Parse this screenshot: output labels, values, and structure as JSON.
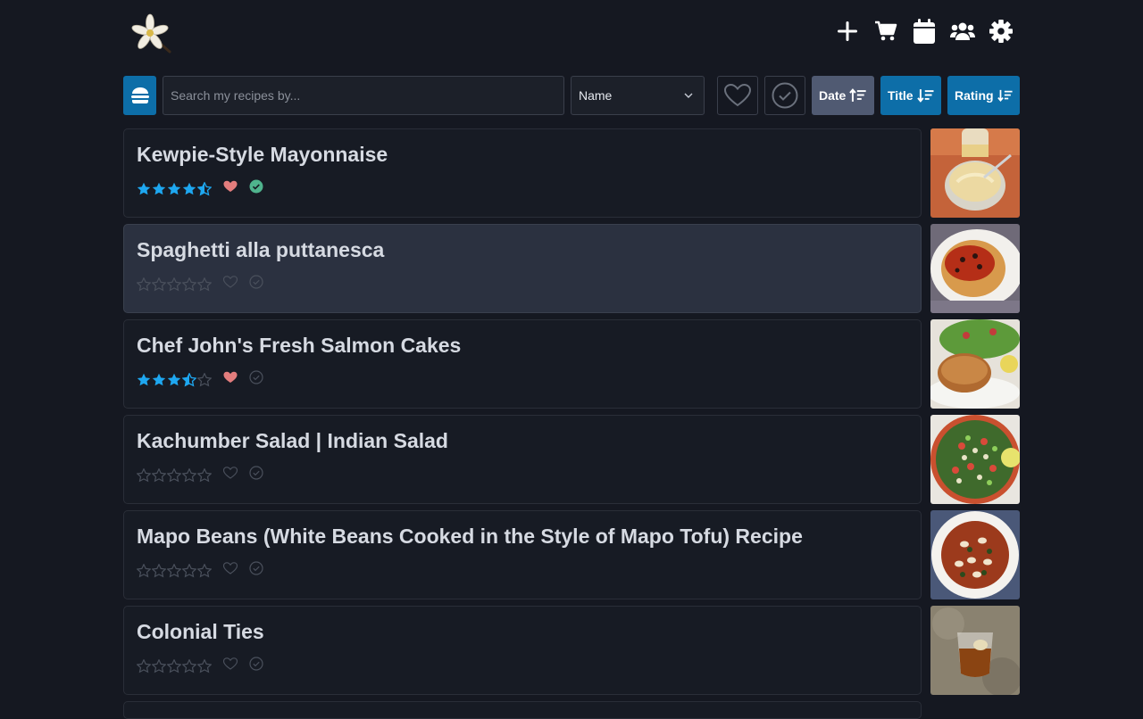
{
  "header": {
    "logo": "vanilla-flower-logo",
    "actions": [
      {
        "name": "add-recipe-button",
        "icon": "plus-icon"
      },
      {
        "name": "shopping-cart-button",
        "icon": "cart-icon"
      },
      {
        "name": "meal-planner-button",
        "icon": "calendar-icon"
      },
      {
        "name": "household-button",
        "icon": "users-icon"
      },
      {
        "name": "settings-button",
        "icon": "gear-icon"
      }
    ]
  },
  "toolbar": {
    "menu_icon": "burger-icon",
    "search_placeholder": "Search my recipes by...",
    "search_value": "",
    "search_by": "Name",
    "favorite_filter_icon": "heart-outline-icon",
    "cooked_filter_icon": "check-circle-icon",
    "sort_buttons": [
      {
        "label": "Date",
        "icon": "sort-ascending-icon",
        "active": false
      },
      {
        "label": "Title",
        "icon": "sort-descending-icon",
        "active": true
      },
      {
        "label": "Rating",
        "icon": "sort-descending-icon",
        "active": true
      }
    ]
  },
  "colors": {
    "accent": "#0d6ea8",
    "star_filled": "#1ea7f0",
    "heart_filled": "#e37d7d",
    "check_filled": "#4fb38d",
    "muted": "#4a505c"
  },
  "recipes": [
    {
      "title": "Kewpie-Style Mayonnaise",
      "rating": 4.5,
      "favorite": true,
      "cooked": true,
      "image": "mayonnaise-photo"
    },
    {
      "title": "Spaghetti alla puttanesca",
      "rating": 0,
      "favorite": false,
      "cooked": false,
      "image": "spaghetti-photo"
    },
    {
      "title": "Chef John's Fresh Salmon Cakes",
      "rating": 3.5,
      "favorite": true,
      "cooked": false,
      "image": "salmon-cake-photo"
    },
    {
      "title": "Kachumber Salad | Indian Salad",
      "rating": 0,
      "favorite": false,
      "cooked": false,
      "image": "salad-photo"
    },
    {
      "title": "Mapo Beans (White Beans Cooked in the Style of Mapo Tofu) Recipe",
      "rating": 0,
      "favorite": false,
      "cooked": false,
      "image": "mapo-beans-photo"
    },
    {
      "title": "Colonial Ties",
      "rating": 0,
      "favorite": false,
      "cooked": false,
      "image": "cocktail-photo"
    }
  ]
}
